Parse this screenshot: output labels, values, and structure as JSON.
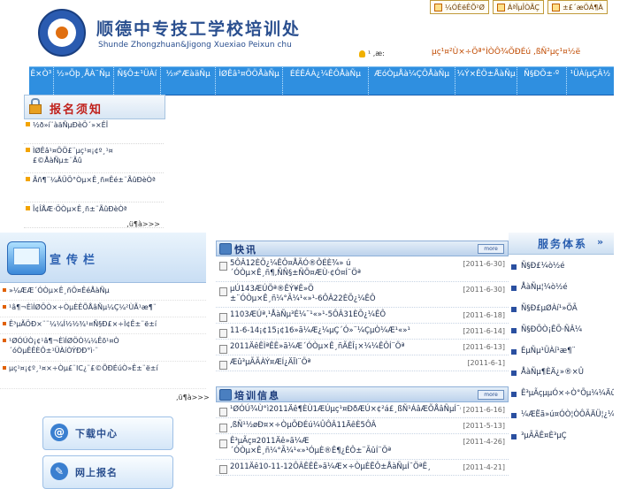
{
  "header": {
    "title": "顺德中专技工学校培训处",
    "subtitle": "Shunde Zhongzhuan&Jigong Xuexiao Peixun chu",
    "top_links": [
      "¼ÓÈëÊÕ²Ø",
      "ÁªÏµÎÒÃÇ",
      "±£´æÖÁ¶À"
    ],
    "date_text": "¹ ,æ:",
    "welcome": "µç¹¤²Ù×÷Öª°ÌÒÔ¾ÕÐÉú ,ßÑ²µç¹¤½ë"
  },
  "nav": {
    "items": [
      "Ê×Ò³",
      "½»Õþ¸ÅÀ¨Ñµ",
      "Ñ§Ô±¹ÜÀí",
      "½»ͨ°ÆàäÑµ",
      "ÌØÊâ¹¤ÖÖÅàÑµ",
      "ÉÉÊÁÀ¿¼ÊÔÅàÑµ",
      "ÆóÒµÅà¼ÇÔÅàÑµ",
      "¼Ý×ÊÖ±ÅàÑµ",
      "Ñ§ÐÕ±·º",
      "¹ÜÀíµÇÂ½"
    ]
  },
  "notice": {
    "title": "报名须知",
    "items": [
      "½ð»í¨àäÑµÐèÖ´»×ÊÎ",
      "ÌØÊâ¹¤ÖÖ£¨µç¹¤¡¢º¸¹¤£©ÅàÑµ±¨Ãû",
      "Ãñ¶¨¼ÄÜÖ°Òµ×Ê¸ñ¤Êé±¨ÃûÐèÒª",
      "Î¢ÎÅÆ·ÖÒµ×Ê¸ñ±¨ÃûÐèÒª"
    ],
    "more": ",ü¶à>>>"
  },
  "promo": {
    "title": "宣传栏",
    "items": [
      "»¼ÆÆ´ÓÒµ×Ê¸ñÖ¤ÊéÅàÑµ",
      "¹â¶¬ÈìÍØÖÒ×÷ÒµÈÊÕÅâÑµ¼Ç¼²ÙÃ¹æ¶¨",
      "Ê³µÃÖÐ×¨¨¼¼Í½½¾¹¤Ñ§Ð£×÷Ì¢Ê±¨ë±í",
      "¹ØÓÚÒ¡¢¹â¶¬ÈìÍØÖÒ¼¼Êõ¹¤Ò ´óÒµÊÊÈÔ±¹ÜÀíÒÝÐÐ°ì·¨",
      "µç¹¤¡¢º¸¹¤×÷Òµ£¨IC¿¨£©ÕÐÉúÒ»Ê±¨ë±í"
    ],
    "more": ",ü¶à>>>",
    "download_label": "下载中心",
    "register_label": "网上报名"
  },
  "kuaixun": {
    "title": "快讯",
    "more_label": "more",
    "rows": [
      {
        "title": "5ÔÂ12ÈÕ¿¼ÊÔ¤ÅÃÓ®ÔÉÈ¾» ú´ÓÒµ×Ê¸ñ¶,ÑÑ§±ÑÖ¤ÆÙ·¢Ó¤Í¨Öª",
        "date": "[2011-6-30]"
      },
      {
        "title": "µÚ143ÆÚÖª®ÊÝ¥Ê»Ö ±¨ÓÒµ×Ê¸ñ¼°Ã¼¹«»¹-6ÔÂ22ÈÕ¿¼ÊÔ",
        "date": "[2011-6-30]"
      },
      {
        "title": "1103ÆÚª,¹ÅàÑµ³É¼¨¹«»¹-5ÔÂ31ÈÕ¿¼ÊÔ",
        "date": "[2011-6-18]"
      },
      {
        "title": "11-6-14¡¢15¡¢16»ã¼Æ¿¼µÇ´Ó»¨¼ÇµÒ¼Æ¹«»¹",
        "date": "[2011-6-14]"
      },
      {
        "title": "2011ÄêÊÌªÊÊ»ã¼Æ´ÓÒµ×Ê¸ñÃÊÎ¡×¼¼ÊÔÍ¨Öª",
        "date": "[2011-6-13]"
      },
      {
        "title": "Æû³µÃÃÀÝ¤ÆÍ¿ÄÏI¨Öª",
        "date": "[2011-6-1]"
      }
    ]
  },
  "peixun": {
    "title": "培训信息",
    "more_label": "more",
    "rows": [
      {
        "title": "¹ØÓÚ¾Ù°ì2011Äê¶ÈÙ1ÆÚµç¹¤ÐðÆÚ×¢²á£¸ßÑ¹ÁâÆÕÅâÑµÍ¨Öª",
        "date": "[2011-6-16]"
      },
      {
        "title": ",ßÑ¹½øÐ¤×÷ÒµÕÐÉú¼ÛÔÂ11ÄêÈ5ÔÂ",
        "date": "[2011-5-13]"
      },
      {
        "title": "Ê³µÃç¤2011Äê»ã¼Æ´ÓÒµ×Ê¸ñ¼°Ã¼¹«»¹ÓµÈ®Ê¶¿ÊÔ±¨ÃûÍ¨Öª",
        "date": "[2011-4-26]"
      },
      {
        "title": "2011Äê10-11-12ÔÂÊÊÊ»ã¼Æ×÷ÒµÈËÔ±ÅàÑµÍ¨ÖªÊ¸",
        "date": "[2011-4-21]"
      }
    ]
  },
  "service": {
    "title": "服务体系",
    "items": [
      "Ñ§Ð£¼ò½é",
      "ÅàÑµ¦¼ò½é",
      "Ñ§Ð£µØÀí¹»ÖÃ",
      "Ñ§ÐÕÒ¡ÊÕ·ÑÂ¼",
      "ÉµÑµ¹ÜÀí¹æ¶¨",
      "ÅàÑµ¶ÈÄ¿»®×Û",
      "Ê³µÃçµµÓ×÷Ò°Õµ¼¼Äû¶¶ÈÉú",
      "¼ÆËã»ú¤ÓÒ¦ÒÔÃÄÜ¦¿¼ÊÔ±¨Ãû",
      "³µÃÃÊ¤È³µÇ"
    ]
  },
  "colors": {
    "nav_bg": "#2f8fe0",
    "title_blue": "#2a4f8f",
    "notice_red": "#c0201a",
    "bullet_orange": "#f3a400"
  }
}
